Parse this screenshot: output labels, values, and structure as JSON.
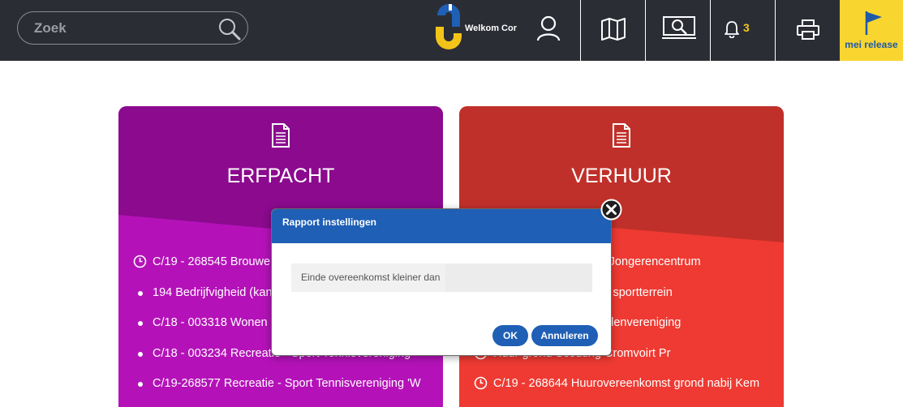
{
  "header": {
    "search_placeholder": "Zoek",
    "welcome": "Welkom Cor",
    "notification_count": "3",
    "release_label": "mei release"
  },
  "cards": [
    {
      "title": "ERFPACHT",
      "color_top": "#8b0a8e",
      "color_bottom": "#b412b8",
      "items": [
        {
          "icon": "clock-icon",
          "text": "C/19 - 268545 Brouwerij"
        },
        {
          "icon": "bullet",
          "text": "194 Bedrijfvigheid (kantoor)"
        },
        {
          "icon": "bullet",
          "text": "C/18 - 003318 Wonen"
        },
        {
          "icon": "bullet",
          "text": "C/18 - 003234 Recreatie - Sport Tennisvereniging"
        },
        {
          "icon": "bullet",
          "text": "C/19-268577 Recreatie - Sport Tennisvereniging 'W"
        }
      ]
    },
    {
      "title": "VERHUUR",
      "color_top": "#c0302a",
      "color_bottom": "#ee3a32",
      "items": [
        {
          "icon": "clock-icon",
          "text": "C/17-223820 Verhuur Jongerencentrum"
        },
        {
          "icon": "bullet",
          "text": "Gebruik voordelijk van sportterrein"
        },
        {
          "icon": "bullet",
          "text": "Huur grond Politiehondenvereniging"
        },
        {
          "icon": "clock-icon",
          "text": "Huur grond Scouting Cromvoirt Pr"
        },
        {
          "icon": "clock-icon",
          "text": "C/19 - 268644 Huurovereenkomst grond nabij Kem"
        }
      ]
    }
  ],
  "dialog": {
    "title": "Rapport instellingen",
    "field_label": "Einde overeenkomst kleiner dan",
    "field_value": "",
    "ok_label": "OK",
    "cancel_label": "Annuleren"
  }
}
